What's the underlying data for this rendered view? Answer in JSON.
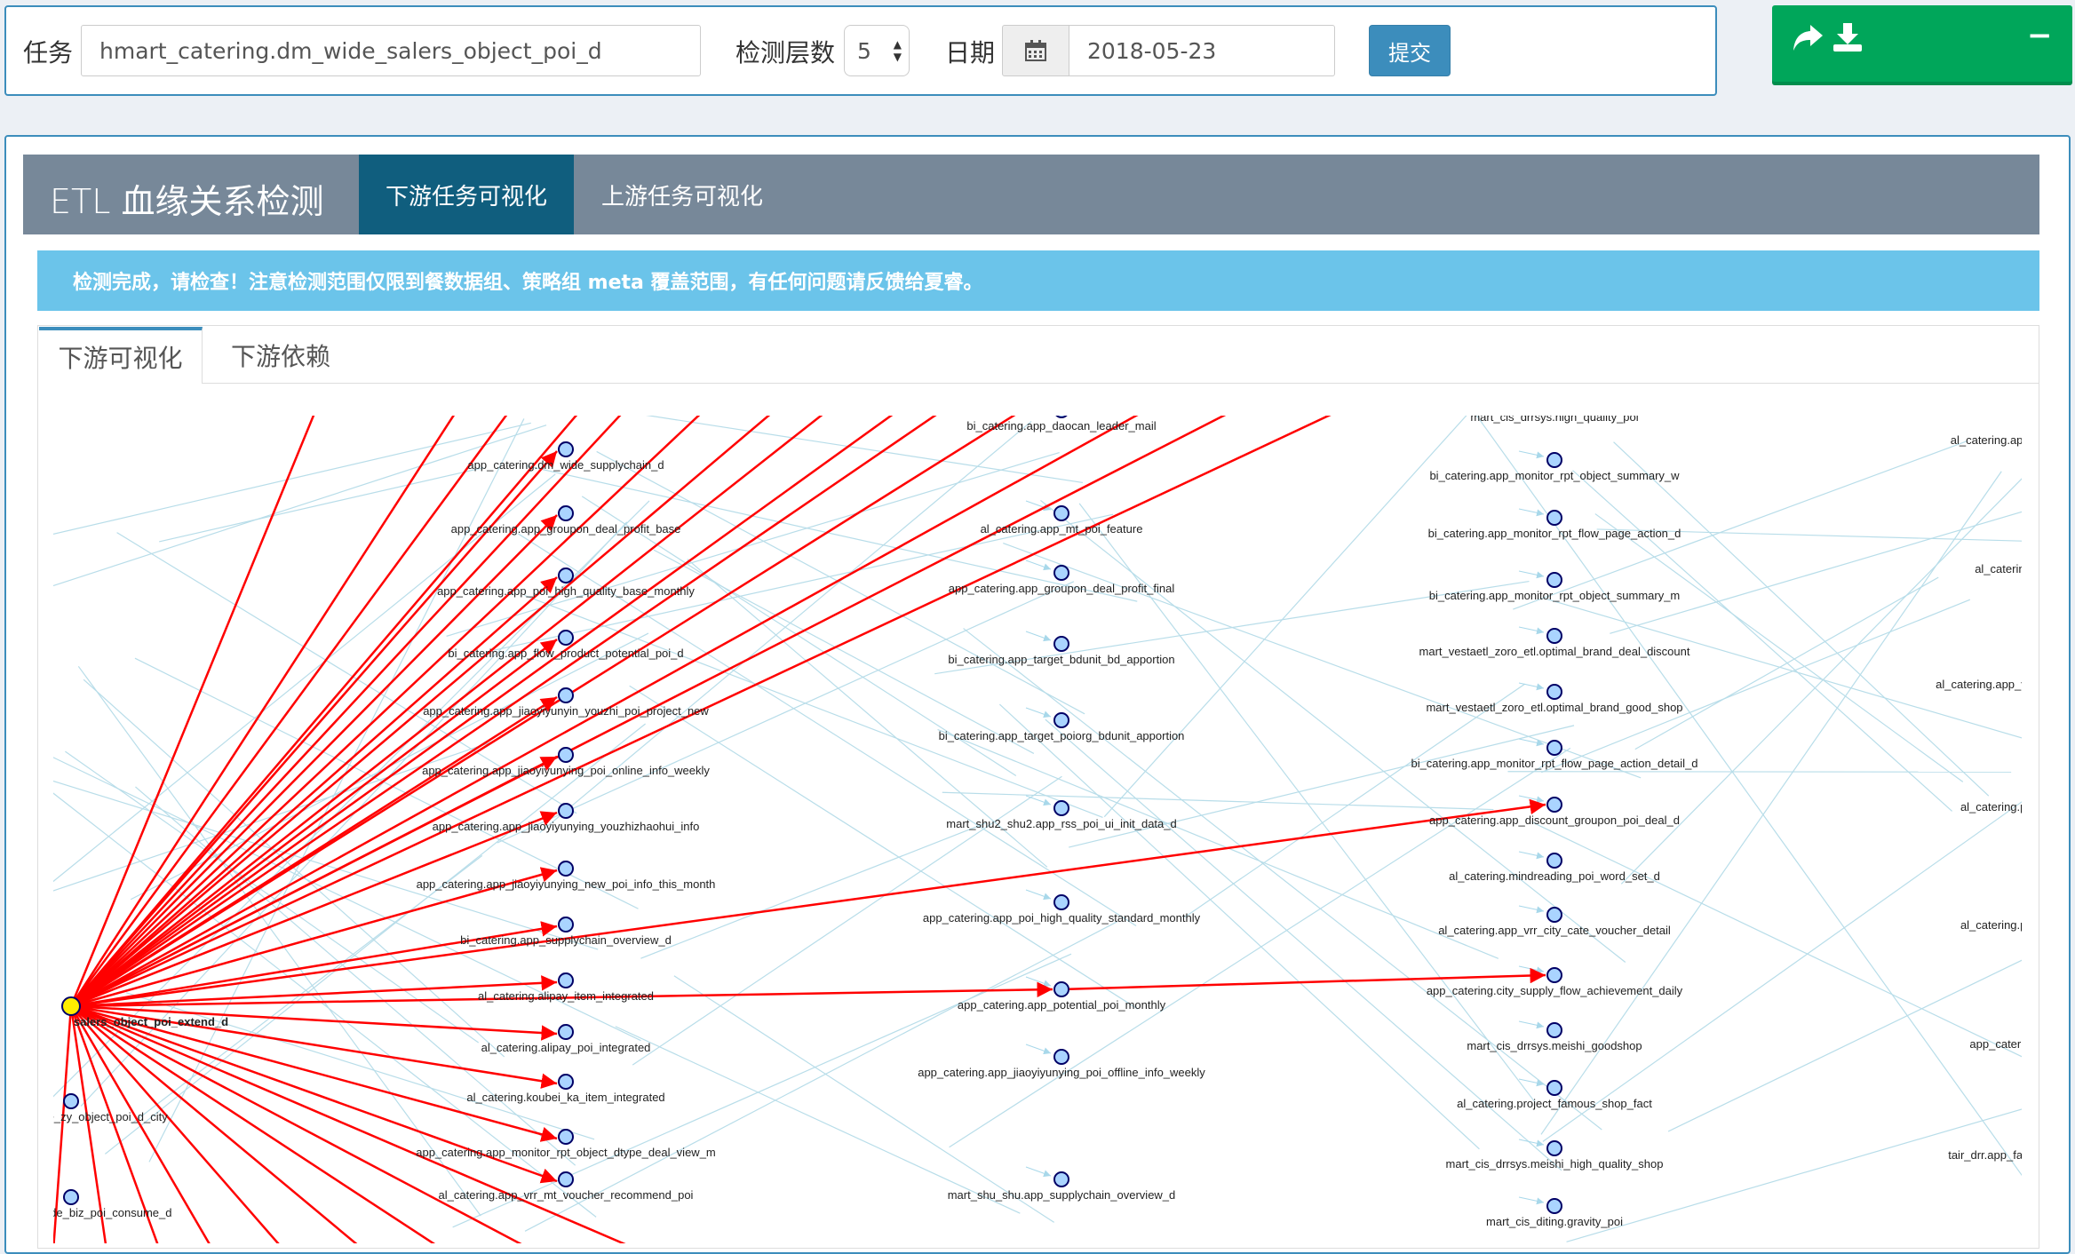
{
  "form": {
    "task_label": "任务",
    "task_value": "hmart_catering.dm_wide_salers_object_poi_d",
    "depth_label": "检测层数",
    "depth_value": "5",
    "date_label": "日期",
    "date_value": "2018-05-23",
    "submit_label": "提交"
  },
  "widget": {
    "collapse_symbol": "−",
    "icons": [
      "share-icon",
      "download-icon"
    ]
  },
  "header": {
    "title": "ETL 血缘关系检测",
    "tabs": [
      "下游任务可视化",
      "上游任务可视化"
    ]
  },
  "alert": "检测完成，请检查！注意检测范围仅限到餐数据组、策略组 meta 覆盖范围，有任何问题请反馈给夏睿。",
  "subtabs": [
    "下游可视化",
    "下游依赖"
  ],
  "graph": {
    "colors": {
      "edge_highlight": "#ff0000",
      "edge_faint": "#b8dde9",
      "node_fill": "#aad4ff",
      "root_fill": "#ffee00"
    },
    "root_label": "salers_object_poi_extend_d",
    "col0": [
      "trade_zy_object_poi_d_city",
      "a_trade_biz_poi_consume_d"
    ],
    "col1": [
      "app_catering.dm_wide_supplychain_d",
      "app_catering.app_groupon_deal_profit_base",
      "app_catering.app_poi_high_quality_base_monthly",
      "bi_catering.app_flow_product_potential_poi_d",
      "app_catering.app_jiaoyiyunyin_youzhi_poi_project_new",
      "app_catering.app_jiaoyiyunying_poi_online_info_weekly",
      "app_catering.app_jiaoyiyunying_youzhizhaohui_info",
      "app_catering.app_jiaoyiyunying_new_poi_info_this_month",
      "bi_catering.app_supplychain_overview_d",
      "al_catering.alipay_item_integrated",
      "al_catering.alipay_poi_integrated",
      "al_catering.koubei_ka_item_integrated",
      "app_catering.app_monitor_rpt_object_dtype_deal_view_m",
      "al_catering.app_vrr_mt_voucher_recommend_poi"
    ],
    "col2": [
      "bi_catering.app_daocan_leader_mail",
      "al_catering.app_mt_poi_feature",
      "app_catering.app_groupon_deal_profit_final",
      "bi_catering.app_target_bdunit_bd_apportion",
      "bi_catering.app_target_poiorg_bdunit_apportion",
      "mart_shu2_shu2.app_rss_poi_ui_init_data_d",
      "app_catering.app_poi_high_quality_standard_monthly",
      "app_catering.app_potential_poi_monthly",
      "app_catering.app_jiaoyiyunying_poi_offline_info_weekly",
      "mart_shu_shu.app_supplychain_overview_d"
    ],
    "col3": [
      "mart_cis_drrsys.high_quality_poi",
      "bi_catering.app_monitor_rpt_object_summary_w",
      "bi_catering.app_monitor_rpt_flow_page_action_d",
      "bi_catering.app_monitor_rpt_object_summary_m",
      "mart_vestaetl_zoro_etl.optimal_brand_deal_discount",
      "mart_vestaetl_zoro_etl.optimal_brand_good_shop",
      "bi_catering.app_monitor_rpt_flow_page_action_detail_d",
      "app_catering.app_discount_groupon_poi_deal_d",
      "al_catering.mindreading_poi_word_set_d",
      "al_catering.app_vrr_city_cate_voucher_detail",
      "app_catering.city_supply_flow_achievement_daily",
      "mart_cis_drrsys.meishi_goodshop",
      "al_catering.project_famous_shop_fact",
      "mart_cis_drrsys.meishi_high_quality_shop",
      "mart_cis_diting.gravity_poi"
    ],
    "col4": [
      "al_catering.app_vrr_",
      "al_catering",
      "al_catering.app_vrr_city_c",
      "al_catering.proje",
      "al_catering.proje",
      "app_catering",
      "tair_drr.app_fact_vrr_"
    ]
  }
}
